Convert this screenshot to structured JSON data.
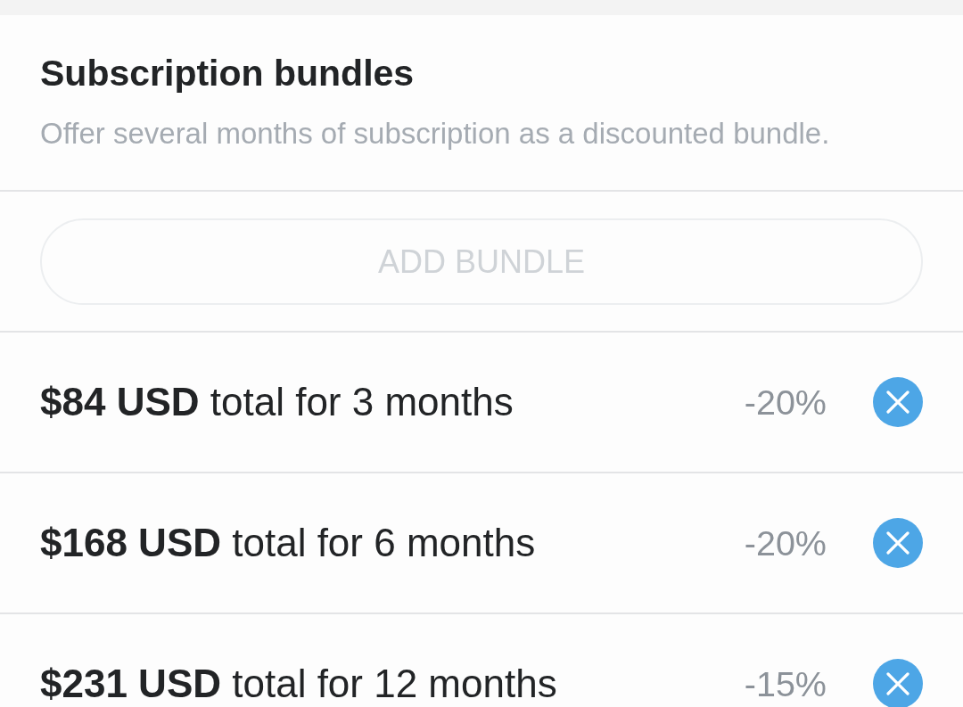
{
  "header": {
    "title": "Subscription bundles",
    "subtitle": "Offer several months of subscription as a discounted bundle."
  },
  "add_button": {
    "label": "ADD BUNDLE",
    "disabled": true
  },
  "bundles": [
    {
      "summary": "**$84 USD** total for 3 months",
      "discount": "-20%"
    },
    {
      "summary": "**$168 USD** total for 6 months",
      "discount": "-20%"
    },
    {
      "summary": "**$231 USD** total for 12 months",
      "discount": "-15%"
    }
  ]
}
